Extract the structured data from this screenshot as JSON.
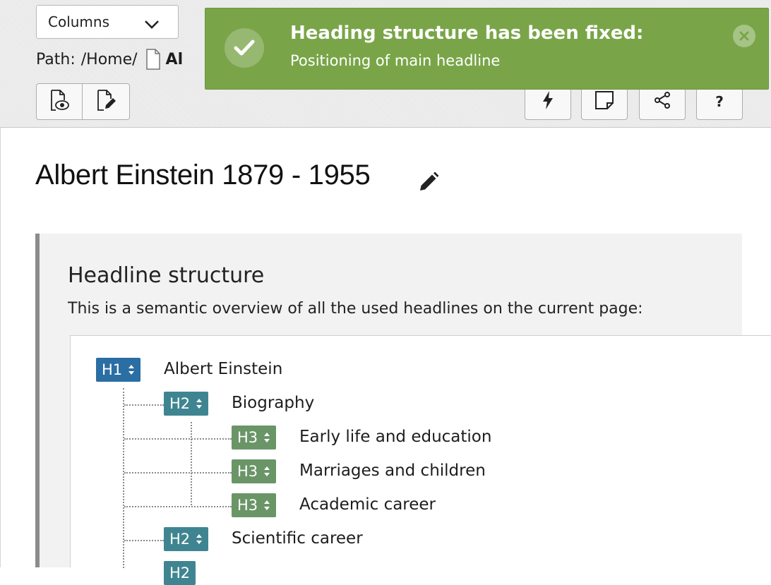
{
  "toolbar": {
    "columns_label": "Columns",
    "path_label": "Path:",
    "path_value": "/Home/",
    "current_page_crumb": "Al",
    "buttons": {
      "help_label": "?"
    }
  },
  "notification": {
    "title": "Heading structure has been fixed:",
    "message": "Positioning of main headline",
    "type": "success"
  },
  "page": {
    "title": "Albert Einstein 1879 - 1955"
  },
  "headline_panel": {
    "title": "Headline structure",
    "description": "This is a semantic overview of all the used headlines on the current page:",
    "items": [
      {
        "level": "H1",
        "text": "Albert Einstein"
      },
      {
        "level": "H2",
        "text": "Biography"
      },
      {
        "level": "H3",
        "text": "Early life and education"
      },
      {
        "level": "H3",
        "text": "Marriages and children"
      },
      {
        "level": "H3",
        "text": "Academic career"
      },
      {
        "level": "H2",
        "text": "Scientific career"
      },
      {
        "level": "H2",
        "text": ""
      }
    ]
  },
  "colors": {
    "success_green": "#79a548",
    "h1_badge": "#2b6ea3",
    "h2_badge": "#3f8591",
    "h3_badge": "#6a9567"
  }
}
